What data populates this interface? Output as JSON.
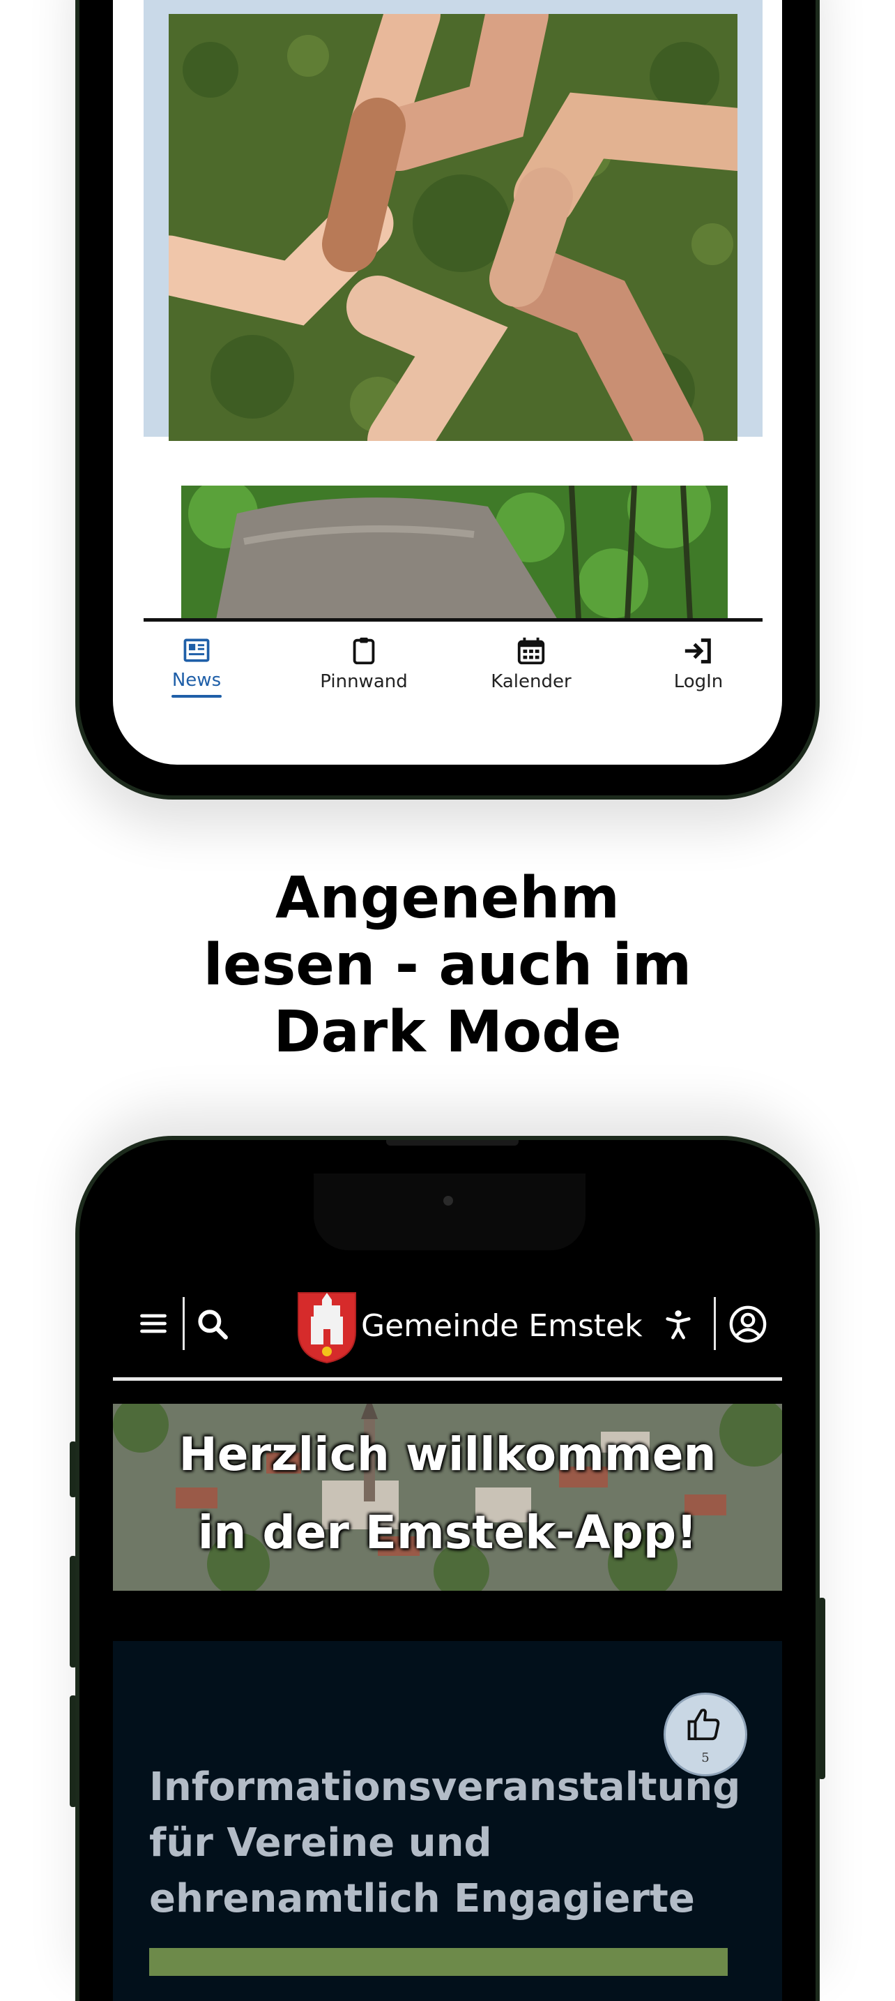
{
  "top_phone": {
    "tabs": [
      {
        "label": "News",
        "icon": "newspaper-icon",
        "active": true
      },
      {
        "label": "Pinnwand",
        "icon": "clipboard-icon",
        "active": false
      },
      {
        "label": "Kalender",
        "icon": "calendar-icon",
        "active": false
      },
      {
        "label": "LogIn",
        "icon": "login-icon",
        "active": false
      }
    ]
  },
  "headline": {
    "line1": "Angenehm",
    "line2": "lesen - auch im",
    "line3": "Dark Mode"
  },
  "bottom_phone": {
    "app_title": "Gemeinde Emstek",
    "banner": {
      "line1": "Herzlich willkommen",
      "line2": "in der Emstek-App!"
    },
    "news": {
      "title": "Informationsveranstaltung für Vereine und ehrenamtlich Engagierte",
      "likes": "5"
    }
  },
  "colors": {
    "active_tab": "#1f5fa8",
    "card_blue": "#c9d9e8",
    "dark_card": "#02101b",
    "phone_frame": "#1c2a1c"
  }
}
